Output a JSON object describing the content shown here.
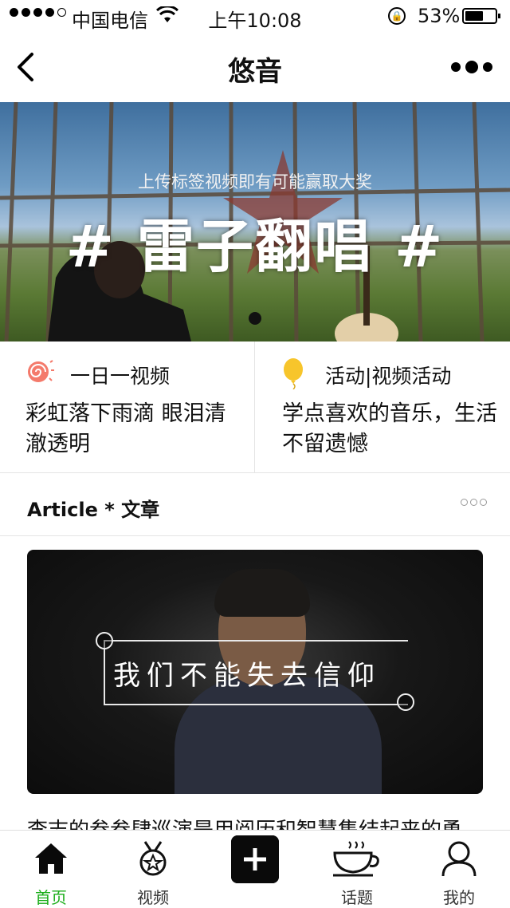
{
  "status_bar": {
    "carrier": "中国电信",
    "time": "上午10:08",
    "battery_percent": "53%",
    "battery_level": 0.53,
    "signal_bars": 4
  },
  "nav": {
    "title": "悠音"
  },
  "banner": {
    "subtitle": "上传标签视频即有可能赢取大奖",
    "headline": "# 雷子翻唱 #",
    "page_indicator": 1
  },
  "cards": [
    {
      "label": "一日一视频",
      "text": "彩虹落下雨滴 眼泪清澈透明",
      "icon": "spiral-icon"
    },
    {
      "label": "活动|视频活动",
      "text": "学点喜欢的音乐，生活不留遗憾",
      "icon": "balloon-icon"
    }
  ],
  "section": {
    "title": "Article * 文章"
  },
  "article": {
    "caption": "我们不能失去信仰",
    "title": "李志的叁叁肆巡演是用阅历和智慧集结起来的勇"
  },
  "tabbar": {
    "items": [
      {
        "label": "首页",
        "icon": "home-icon",
        "active": true
      },
      {
        "label": "视频",
        "icon": "medal-icon",
        "active": false
      },
      {
        "label": "",
        "icon": "plus-icon",
        "active": false
      },
      {
        "label": "话题",
        "icon": "coffee-cup-icon",
        "active": false
      },
      {
        "label": "我的",
        "icon": "user-icon",
        "active": false
      }
    ]
  },
  "colors": {
    "accent_green": "#1aad19",
    "text": "#111111",
    "divider": "#e5e5e5"
  }
}
